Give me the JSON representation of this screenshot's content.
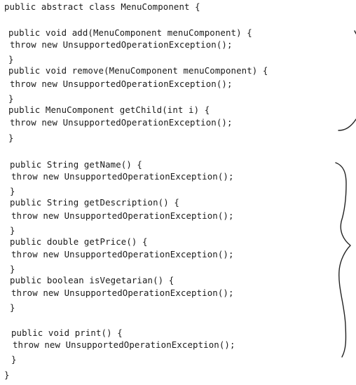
{
  "code": {
    "lines": [
      "public abstract class MenuComponent {",
      "    public void add(MenuComponent menuComponent) {",
      "        throw new UnsupportedOperationException();",
      "    }",
      "    public void remove(MenuComponent menuComponent) {",
      "        throw new UnsupportedOperationException();",
      "    }",
      "    public MenuComponent getChild(int i) {",
      "        throw new UnsupportedOperationException();",
      "    }",
      "    public String getName() {",
      "        throw new UnsupportedOperationException();",
      "    }",
      "    public String getDescription() {",
      "        throw new UnsupportedOperationException();",
      "    }",
      "    public double getPrice() {",
      "        throw new UnsupportedOperationException();",
      "    }",
      "    public boolean isVegetarian() {",
      "        throw new UnsupportedOperationException();",
      "    }",
      "    public void print() {",
      "        throw new UnsupportedOperationException();",
      "    }",
      "}"
    ]
  },
  "annotations": {
    "color": "#222222",
    "marks": [
      "group-bracket-upper",
      "group-bracket-lower"
    ]
  }
}
